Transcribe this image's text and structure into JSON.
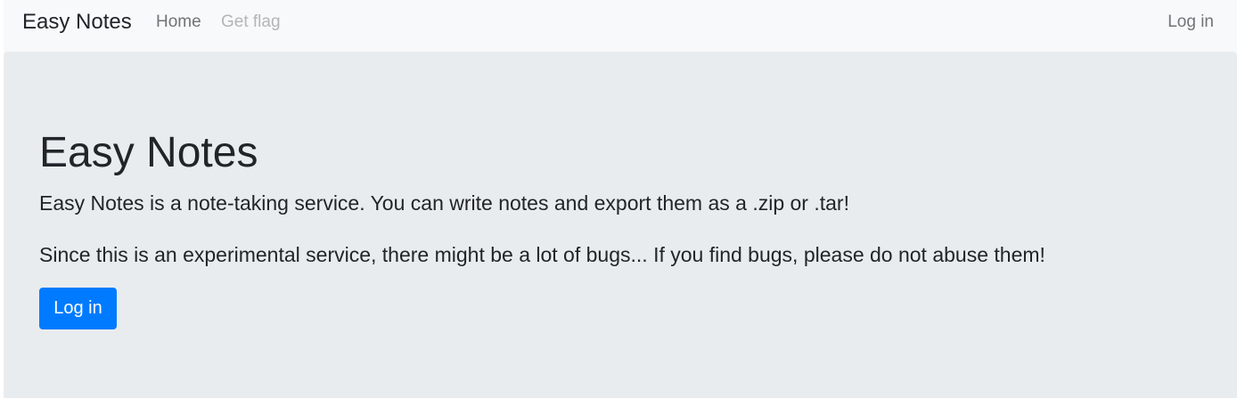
{
  "navbar": {
    "brand": "Easy Notes",
    "links": [
      {
        "label": "Home"
      },
      {
        "label": "Get flag"
      }
    ],
    "login_label": "Log in"
  },
  "jumbotron": {
    "title": "Easy Notes",
    "lead1": "Easy Notes is a note-taking service. You can write notes and export them as a .zip or .tar!",
    "lead2": "Since this is an experimental service, there might be a lot of bugs... If you find bugs, please do not abuse them!",
    "button_label": "Log in"
  },
  "colors": {
    "primary": "#007bff",
    "navbar_bg": "#f8f9fa",
    "jumbotron_bg": "#e9ecef"
  }
}
